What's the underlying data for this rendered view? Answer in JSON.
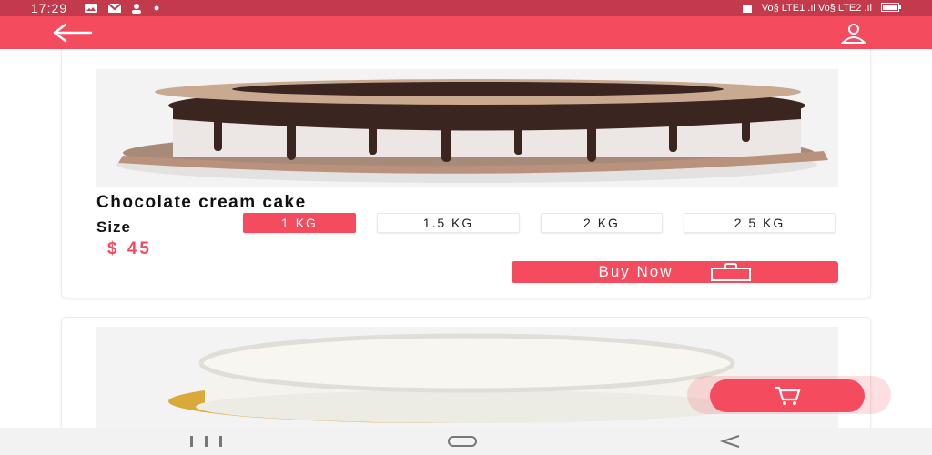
{
  "status_bar": {
    "time": "17:29",
    "left_icons": [
      "gallery-icon",
      "gmail-icon",
      "user-icon",
      "dot-icon"
    ],
    "right_text": "Vo§ LTE1 .ıl Vo§ LTE2 .ıl"
  },
  "app_bar": {
    "back_icon": "arrow-back-icon",
    "profile_icon": "profile-icon",
    "color": "#f54b5e"
  },
  "products": [
    {
      "image": "chocolate-cake",
      "title": "Chocolate cream cake",
      "size_label": "Size",
      "sizes": [
        "1 KG",
        "1.5 KG",
        "2 KG",
        "2.5 KG"
      ],
      "selected_size": "1 KG",
      "price": "$ 45",
      "buy_label": "Buy Now",
      "buy_icon": "shopping-bag-icon"
    },
    {
      "image": "vanilla-cake"
    }
  ],
  "fab": {
    "icon": "cart-icon"
  },
  "nav_bar": {
    "icons": [
      "recents-icon",
      "home-icon",
      "back-icon"
    ]
  }
}
